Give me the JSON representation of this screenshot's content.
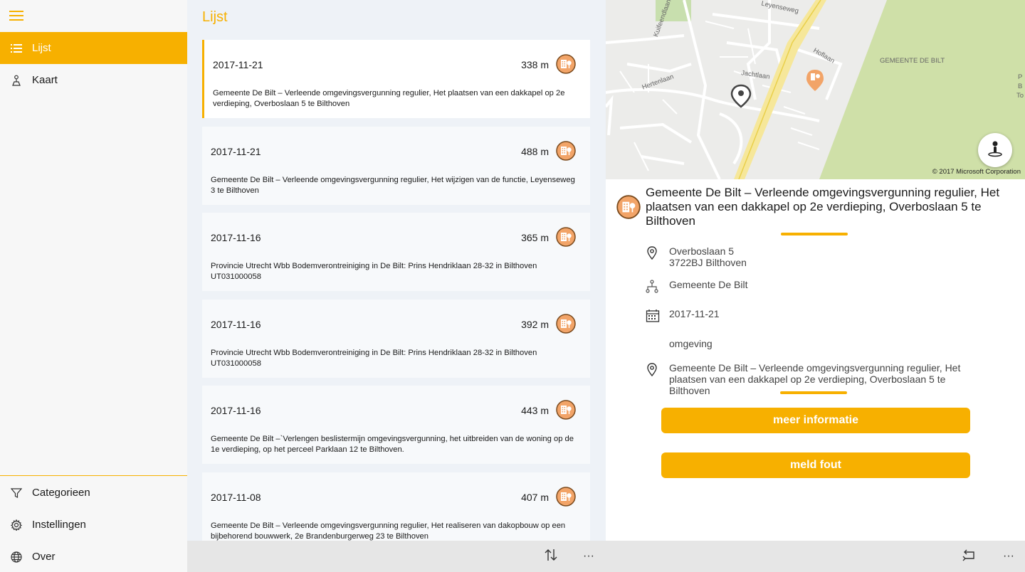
{
  "nav": {
    "menu_icon": "hamburger-icon",
    "items_top": [
      {
        "label": "Lijst",
        "icon": "list-icon",
        "active": true
      },
      {
        "label": "Kaart",
        "icon": "map-person-icon",
        "active": false
      }
    ],
    "items_bottom": [
      {
        "label": "Categorieen",
        "icon": "filter-icon"
      },
      {
        "label": "Instellingen",
        "icon": "gear-icon"
      },
      {
        "label": "Over",
        "icon": "globe-icon"
      }
    ]
  },
  "list": {
    "title": "Lijst",
    "items": [
      {
        "date": "2017-11-21",
        "distance": "338 m",
        "description": "Gemeente De Bilt – Verleende omgevingsvergunning regulier, Het plaatsen van een dakkapel op 2e verdieping, Overboslaan 5 te Bilthoven",
        "selected": true
      },
      {
        "date": "2017-11-21",
        "distance": "488 m",
        "description": "Gemeente De Bilt – Verleende omgevingsvergunning regulier, Het wijzigen van de functie, Leyenseweg 3 te Bilthoven",
        "selected": false
      },
      {
        "date": "2017-11-16",
        "distance": "365 m",
        "description": "Provincie Utrecht Wbb Bodemverontreiniging in De Bilt: Prins Hendriklaan 28-32 in Bilthoven UT031000058",
        "selected": false
      },
      {
        "date": "2017-11-16",
        "distance": "392 m",
        "description": "Provincie Utrecht Wbb Bodemverontreiniging in De Bilt: Prins Hendriklaan 28-32 in Bilthoven UT031000058",
        "selected": false
      },
      {
        "date": "2017-11-16",
        "distance": "443 m",
        "description": "Gemeente De Bilt –`Verlengen beslistermijn omgevingsvergunning, het uitbreiden van de woning op de 1e verdieping, op het perceel Parklaan 12 te Bilthoven.",
        "selected": false
      },
      {
        "date": "2017-11-08",
        "distance": "407 m",
        "description": "Gemeente De Bilt – Verleende omgevingsvergunning regulier, Het realiseren van dakopbouw op een bijbehorend  bouwwerk, 2e Brandenburgerweg 23 te Bilthoven",
        "selected": false
      }
    ]
  },
  "map": {
    "labels": {
      "leyenseweg": "Leyenseweg",
      "hoflaan": "Hoflaan",
      "jachtlaan": "Jachtlaan",
      "hertenlaan": "Hertenlaan",
      "kuifeendlaan": "Kuifeendlaan",
      "gemeente": "GEMEENTE DE BILT",
      "edge1": "P",
      "edge2": "B",
      "edge3": "To"
    },
    "copyright": "© 2017 Microsoft Corporation",
    "locate_icon": "person-locate-icon"
  },
  "detail": {
    "title": "Gemeente De Bilt – Verleende omgevingsvergunning regulier, Het plaatsen van een dakkapel op 2e verdieping, Overboslaan 5 te Bilthoven",
    "address_line1": "Overboslaan 5",
    "address_line2": "3722BJ Bilthoven",
    "organization": "Gemeente De Bilt",
    "date": "2017-11-21",
    "category": "omgeving",
    "description": "Gemeente De Bilt – Verleende omgevingsvergunning regulier, Het plaatsen van een dakkapel op 2e verdieping, Overboslaan 5 te Bilthoven",
    "more_info_label": "meer informatie",
    "report_label": "meld fout"
  },
  "bottombar": {
    "sort_icon": "sort-icon",
    "more_label": "···",
    "rotate_icon": "repeat-icon",
    "more_label_right": "···"
  },
  "colors": {
    "accent": "#f7b000",
    "icon_fill": "#f2a468",
    "icon_border": "#7a4a1d"
  }
}
